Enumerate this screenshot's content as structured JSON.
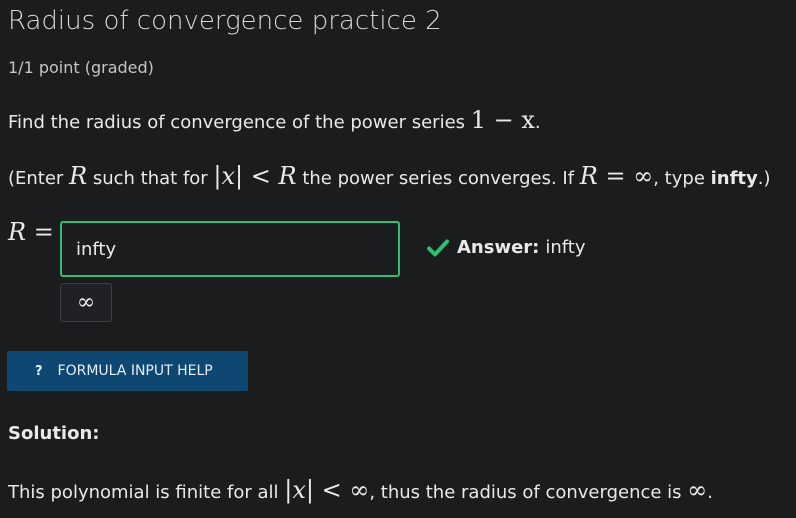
{
  "problem": {
    "title": "Radius of convergence practice 2",
    "points": "1/1 point (graded)",
    "question": {
      "text": "Find the radius of convergence of the power series ",
      "series": "1 − x",
      "end": "."
    },
    "hint": {
      "part1": "(Enter ",
      "R": "R",
      "part2": " such that for ",
      "abs_x": "|x|",
      "lt": " < ",
      "R2": "R",
      "part3": " the power series converges. If ",
      "R3": "R",
      "eq": " = ",
      "inf": "∞",
      "part4": ", type ",
      "keyword": "infty",
      "part5": ".)"
    }
  },
  "answer": {
    "label": "R =",
    "input_value": "infty",
    "preview": "∞",
    "status_label": "Answer:",
    "status_value": "infty",
    "correct_color": "#2fbf71"
  },
  "help_button": {
    "icon": "?",
    "label": "FORMULA INPUT HELP"
  },
  "solution": {
    "label": "Solution:",
    "text1": "This polynomial is finite for all ",
    "abs_x": "|x|",
    "lt": " < ",
    "inf": "∞",
    "text2": ", thus the radius of convergence is ",
    "inf2": "∞",
    "end": "."
  }
}
